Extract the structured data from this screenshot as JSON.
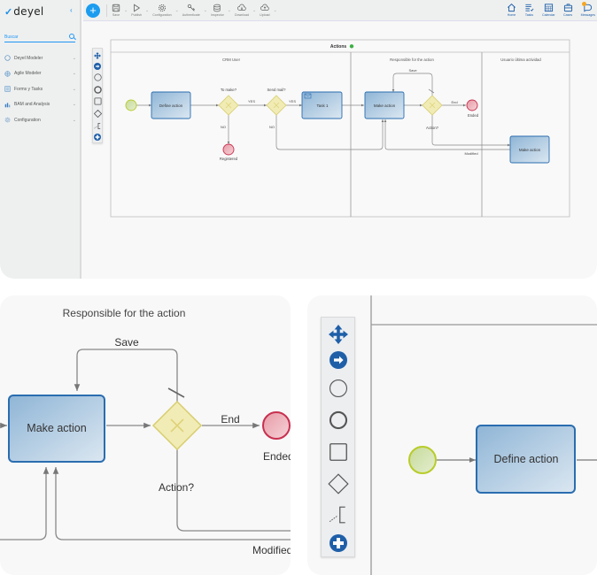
{
  "app": {
    "logo_text": "deyel",
    "collapse_icon": "chevron-left-icon"
  },
  "sidebar": {
    "search_placeholder": "Buscar",
    "items": [
      {
        "label": "Deyel Modeler",
        "icon": "circle-icon"
      },
      {
        "label": "Agile Modeler",
        "icon": "globe-icon"
      },
      {
        "label": "Forms y Tasks",
        "icon": "form-icon"
      },
      {
        "label": "BAM and Analysis",
        "icon": "bar-chart-icon"
      },
      {
        "label": "Configuration",
        "icon": "gear-icon"
      }
    ]
  },
  "toolbar": {
    "add_label": "+",
    "buttons": [
      {
        "label": "Save",
        "icon": "save-icon"
      },
      {
        "label": "Publish",
        "icon": "play-icon"
      },
      {
        "label": "Configuration",
        "icon": "gear-icon"
      },
      {
        "label": "Authenticate",
        "icon": "key-icon"
      },
      {
        "label": "Inspector",
        "icon": "layers-icon"
      },
      {
        "label": "Download",
        "icon": "cloud-download-icon"
      },
      {
        "label": "Upload",
        "icon": "cloud-upload-icon"
      }
    ],
    "right_buttons": [
      {
        "label": "Home",
        "icon": "home-icon"
      },
      {
        "label": "Tasks",
        "icon": "tasks-icon"
      },
      {
        "label": "Calendar",
        "icon": "calendar-icon"
      },
      {
        "label": "Cases",
        "icon": "briefcase-icon"
      },
      {
        "label": "Messages",
        "icon": "message-icon",
        "has_badge": true
      }
    ]
  },
  "palette": {
    "tools": [
      "move-icon",
      "connect-arrow-icon",
      "start-event-icon",
      "end-event-icon",
      "task-icon",
      "gateway-icon",
      "annotation-icon",
      "more-icon"
    ]
  },
  "diagram": {
    "pool_title": "Actions",
    "pool_status_color": "#3cb043",
    "lanes": [
      "CRM User",
      "Responsible for the action",
      "Usuario última actividad"
    ],
    "tasks": {
      "define_action": "Define action",
      "task1": "Task 1",
      "make_action": "Make action",
      "make_action_2": "Make action"
    },
    "gateways": {
      "to_make": "To make?",
      "send_mail": "Send mail?",
      "action": "Action?"
    },
    "events": {
      "registered": "Registered",
      "ended": "Ended"
    },
    "flow_labels": {
      "yes1": "YES",
      "no1": "NO",
      "yes2": "YES",
      "no2": "NO",
      "save": "Save",
      "end": "End",
      "modified": "Modified"
    },
    "colors": {
      "task_fill_start": "#8fb5d6",
      "task_fill_end": "#dbe7f1",
      "task_stroke": "#2a6db0",
      "gateway_fill": "#f1ecb5",
      "gateway_stroke": "#d8cd6e",
      "start_fill": "#d4e4b2",
      "start_stroke": "#b8cc2a",
      "end_fill": "#f0b8c0",
      "end_stroke": "#c8304f",
      "accent": "#1b9cef"
    }
  },
  "zoom_left": {
    "lane_label": "Responsible for the action",
    "task_label": "Make action",
    "save_label": "Save",
    "end_label": "End",
    "ended_label": "Ended",
    "action_label": "Action?",
    "modified_label": "Modified"
  },
  "zoom_right": {
    "task_label": "Define action"
  }
}
